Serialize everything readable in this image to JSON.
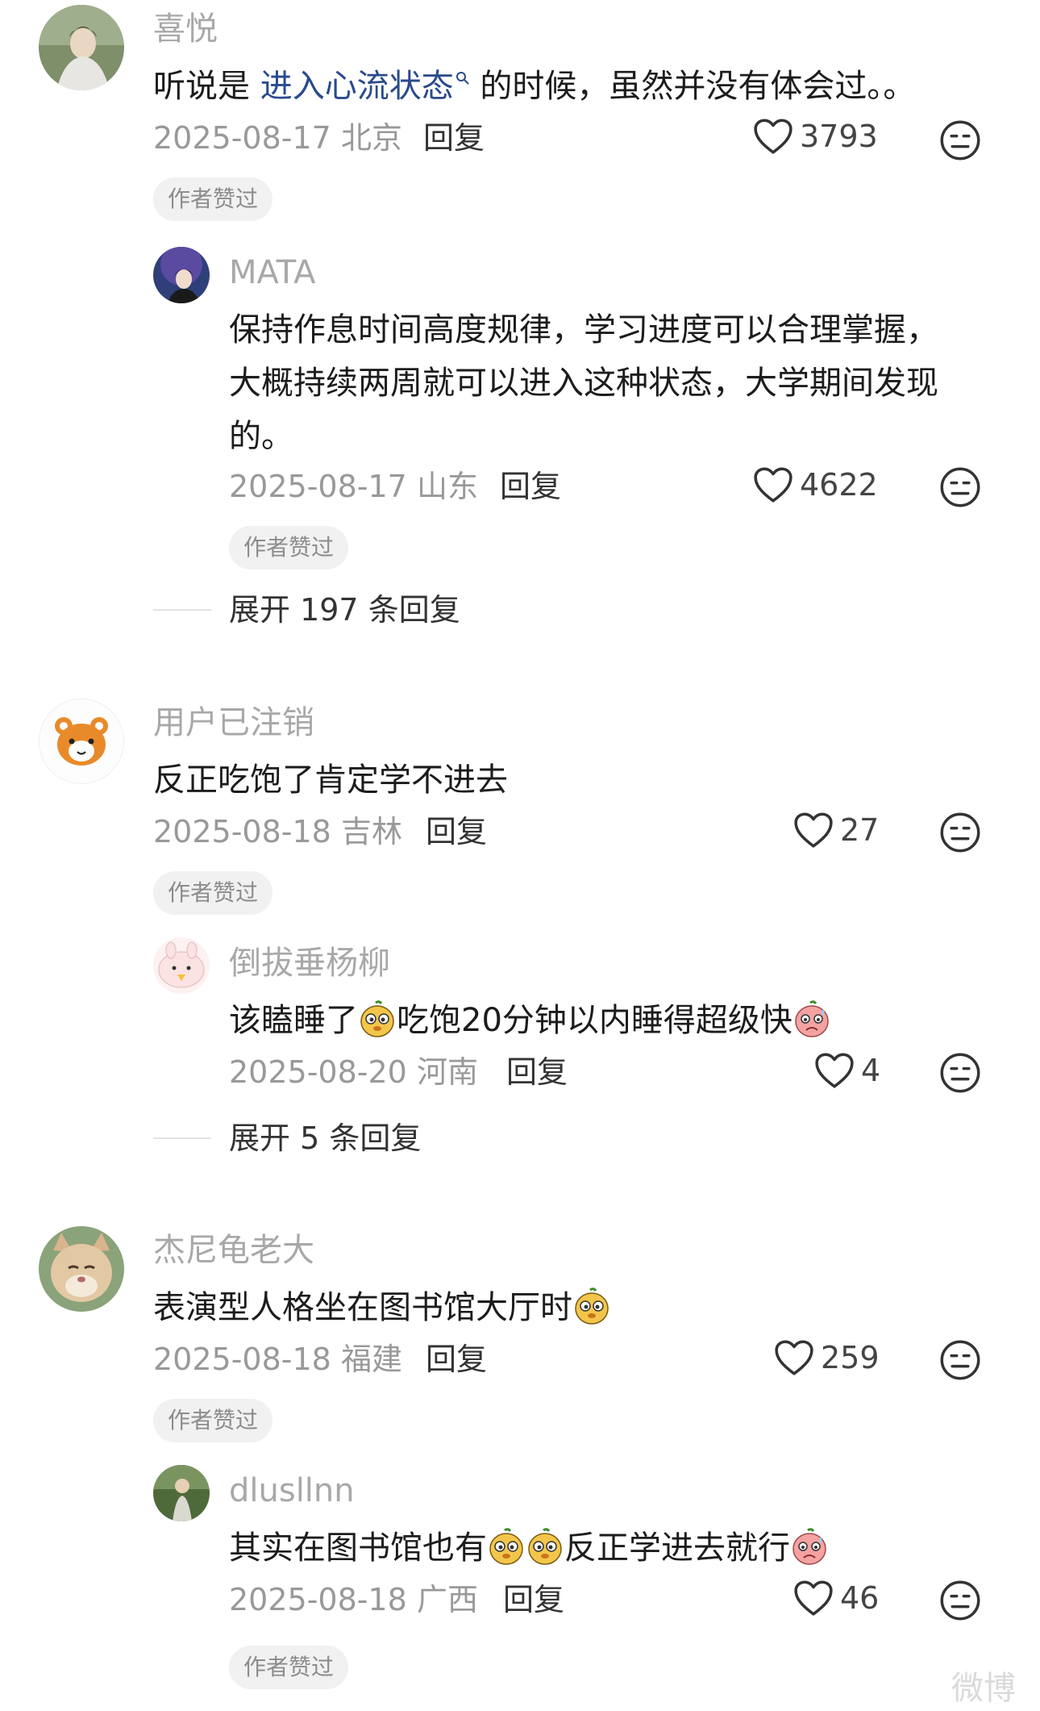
{
  "comments": [
    {
      "user": "喜悦",
      "text_before": "听说是 ",
      "link": "进入心流状态",
      "text_after": " 的时候，虽然并没有体会过。。",
      "date": "2025-08-17",
      "location": "北京",
      "reply_label": "回复",
      "likes": "3793",
      "badge": "作者赞过",
      "sub": {
        "user": "MATA",
        "lines": [
          "保持作息时间高度规律，学习进度可以合理掌握，",
          "大概持续两周就可以进入这种状态，大学期间发现",
          "的。"
        ],
        "date": "2025-08-17",
        "location": "山东",
        "reply_label": "回复",
        "likes": "4622",
        "badge": "作者赞过"
      },
      "expand": "展开 197 条回复"
    },
    {
      "user": "用户已注销",
      "text": "反正吃饱了肯定学不进去",
      "date": "2025-08-18",
      "location": "吉林",
      "reply_label": "回复",
      "likes": "27",
      "badge": "作者赞过",
      "sub": {
        "user": "倒拔垂杨柳",
        "text_a": "该瞌睡了",
        "text_b": "吃饱20分钟以内睡得超级快",
        "date": "2025-08-20",
        "location": "河南",
        "reply_label": "回复",
        "likes": "4"
      },
      "expand": "展开 5 条回复"
    },
    {
      "user": "杰尼龟老大",
      "text": "表演型人格坐在图书馆大厅时",
      "date": "2025-08-18",
      "location": "福建",
      "reply_label": "回复",
      "likes": "259",
      "badge": "作者赞过",
      "sub": {
        "user": "dlusllnn",
        "text_a": "其实在图书馆也有",
        "text_b": "反正学进去就行",
        "date": "2025-08-18",
        "location": "广西",
        "reply_label": "回复",
        "likes": "46",
        "badge": "作者赞过"
      }
    }
  ],
  "watermark": "微博",
  "colors": {
    "link": "#2a4a8c",
    "name": "#a8a8a8",
    "meta": "#999999",
    "badge_bg": "#f1f1f1"
  },
  "icons": [
    "heart-outline-icon",
    "dislike-face-icon",
    "search-icon",
    "pig-emoji",
    "sweat-emoji"
  ]
}
